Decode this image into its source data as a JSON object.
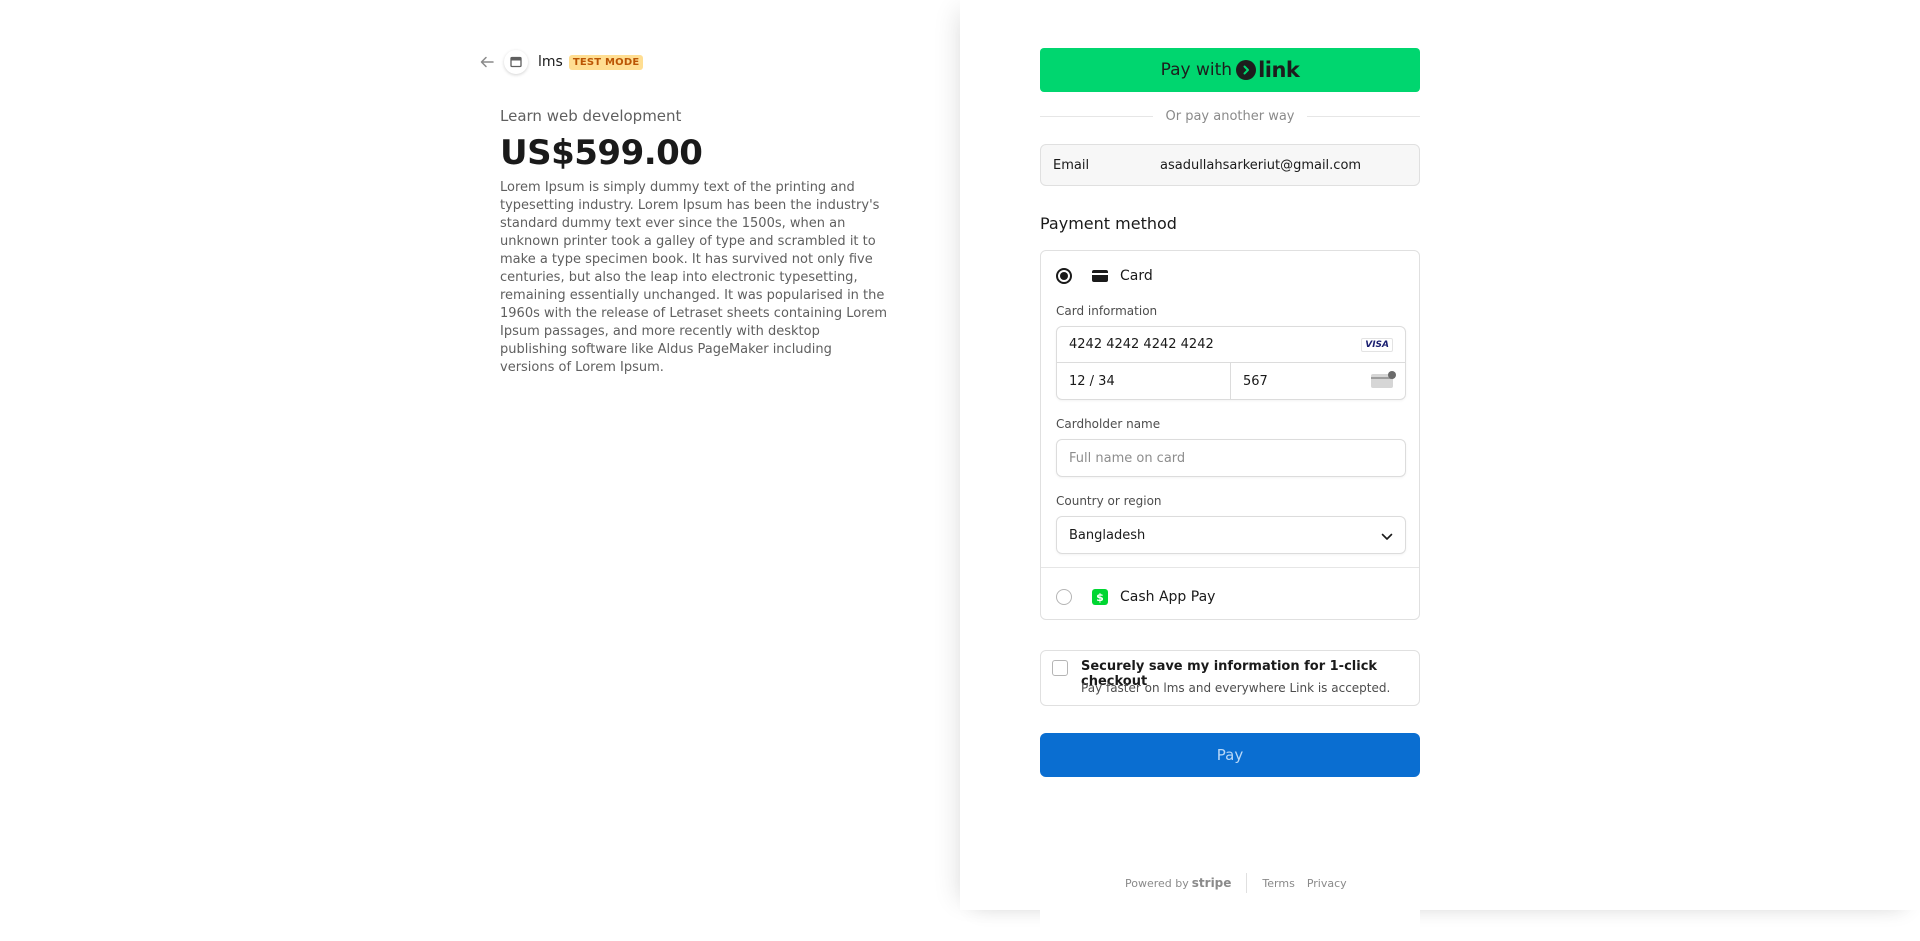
{
  "merchant": {
    "name": "lms",
    "test_badge": "TEST MODE"
  },
  "product": {
    "name": "Learn web development",
    "price": "US$599.00",
    "description": "Lorem Ipsum is simply dummy text of the printing and typesetting industry. Lorem Ipsum has been the industry's standard dummy text ever since the 1500s, when an unknown printer took a galley of type and scrambled it to make a type specimen book. It has survived not only five centuries, but also the leap into electronic typesetting, remaining essentially unchanged. It was popularised in the 1960s with the release of Letraset sheets containing Lorem Ipsum passages, and more recently with desktop publishing software like Aldus PageMaker including versions of Lorem Ipsum."
  },
  "link_button": {
    "prefix": "Pay with",
    "brand": "link"
  },
  "divider_text": "Or pay another way",
  "email": {
    "label": "Email",
    "value": "asadullahsarkeriut@gmail.com"
  },
  "payment_method": {
    "title": "Payment method",
    "card_label": "Card",
    "card_info_label": "Card information",
    "card_number": "4242 4242 4242 4242",
    "card_brand": "VISA",
    "expiry": "12 / 34",
    "cvc": "567",
    "cardholder_label": "Cardholder name",
    "cardholder_placeholder": "Full name on card",
    "country_label": "Country or region",
    "country_value": "Bangladesh",
    "cashapp_label": "Cash App Pay",
    "cashapp_icon_glyph": "$"
  },
  "save_info": {
    "title": "Securely save my information for 1-click checkout",
    "subtitle": "Pay faster on lms and everywhere Link is accepted."
  },
  "pay_button": "Pay",
  "footer": {
    "powered_by": "Powered by",
    "brand": "stripe",
    "terms": "Terms",
    "privacy": "Privacy"
  },
  "colors": {
    "link_green": "#00d66f",
    "pay_blue": "#0a6ed1",
    "test_badge_bg": "#ffde92",
    "test_badge_text": "#bb5504",
    "cashapp_green": "#00d632"
  },
  "icons": {
    "back": "arrow-left-icon",
    "merchant": "store-icon",
    "card": "credit-card-icon",
    "cvc": "cvc-card-icon",
    "chevron": "chevron-down-icon"
  }
}
